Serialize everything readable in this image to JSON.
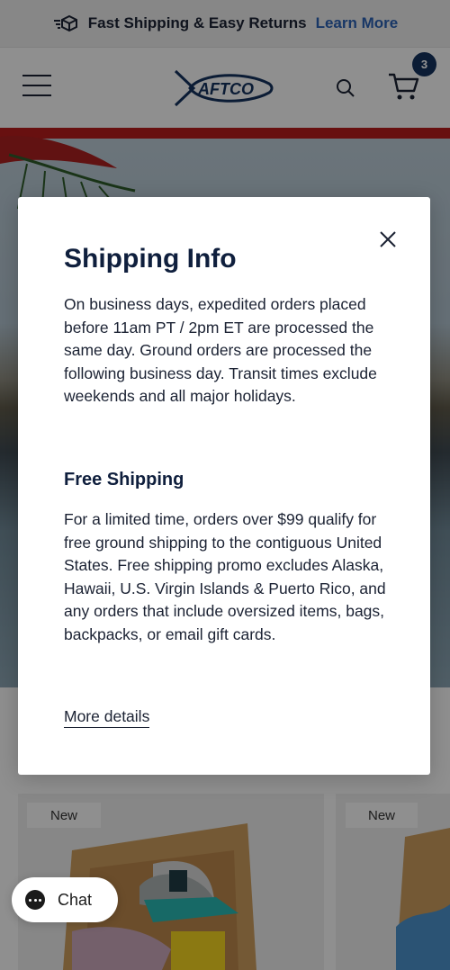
{
  "announcement": {
    "text": "Fast Shipping & Easy Returns",
    "link": "Learn More",
    "icon": "fast-shipping-box-icon"
  },
  "header": {
    "logo_text": "AFTCO",
    "cart_count": "3",
    "icons": [
      "hamburger-menu-icon",
      "search-icon",
      "cart-icon"
    ]
  },
  "products": [
    {
      "badge": "New"
    },
    {
      "badge": "New"
    }
  ],
  "modal": {
    "title": "Shipping Info",
    "intro": "On business days, expedited orders placed before 11am PT / 2pm ET are processed the same day. Ground orders are processed the following business day. Transit times exclude weekends and all major holidays.",
    "section_title": "Free Shipping",
    "section_body": "For a limited time, orders over $99 qualify for free ground shipping to the contiguous United States. Free shipping promo excludes Alaska, Hawaii, U.S. Virgin Islands & Puerto Rico, and any orders that include oversized items, bags, backpacks, or email gift cards.",
    "link": "More details"
  },
  "chat": {
    "label": "Chat"
  },
  "colors": {
    "navy": "#0f1f3d",
    "link_blue": "#2a5fb0",
    "badge": "#13315c"
  }
}
